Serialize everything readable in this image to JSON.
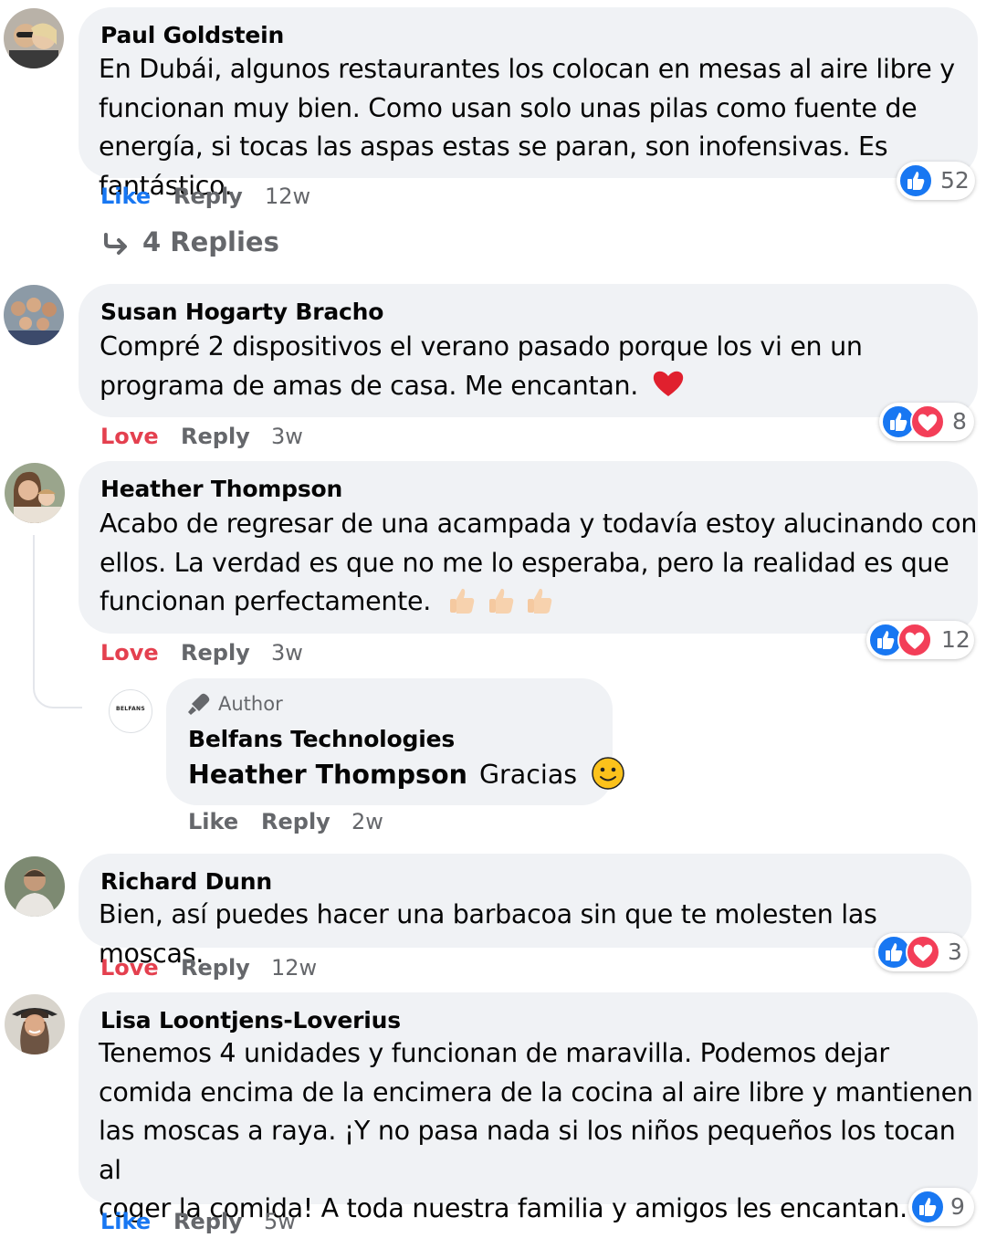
{
  "comments": [
    {
      "author": "Paul Goldstein",
      "lines": [
        "En Dubái, algunos restaurantes los colocan en mesas al aire libre y",
        "funcionan muy bien. Como usan solo unas pilas como fuente de",
        "energía, si tocas las aspas estas se paran, son inofensivas. Es fantástico."
      ],
      "action": "Like",
      "reply": "Reply",
      "time": "12w",
      "reaction_count": "52",
      "replies_label": "4 Replies"
    },
    {
      "author": "Susan Hogarty Bracho",
      "lines": [
        "Compré 2 dispositivos el verano pasado porque los vi en un",
        "programa de amas de casa. Me encantan."
      ],
      "emoji": "heart",
      "action": "Love",
      "reply": "Reply",
      "time": "3w",
      "reaction_count": "8"
    },
    {
      "author": "Heather Thompson",
      "lines": [
        "Acabo de regresar de una acampada y todavía estoy alucinando con",
        "ellos. La verdad es que no me lo esperaba, pero la realidad es que",
        "funcionan perfectamente."
      ],
      "emoji": "thumbs-up x3",
      "action": "Love",
      "reply": "Reply",
      "time": "3w",
      "reaction_count": "12"
    },
    {
      "author": "Richard Dunn",
      "lines": [
        "Bien, así puedes hacer una barbacoa sin que te molesten las moscas."
      ],
      "action": "Love",
      "reply": "Reply",
      "time": "12w",
      "reaction_count": "3"
    },
    {
      "author": "Lisa Loontjens-Loverius",
      "lines": [
        "Tenemos 4 unidades y funcionan de maravilla. Podemos dejar",
        "comida encima de la encimera de la cocina al aire libre y mantienen",
        "las moscas a raya. ¡Y no pasa nada si los niños pequeños los tocan al",
        "coger la comida! A toda nuestra familia y amigos les encantan."
      ],
      "action": "Like",
      "reply": "Reply",
      "time": "5w",
      "reaction_count": "9"
    }
  ],
  "author_reply": {
    "badge": "Author",
    "author": "Belfans Technologies",
    "avatar_text": "BELFANS",
    "mention": "Heather Thompson",
    "text": "Gracias",
    "action": "Like",
    "reply": "Reply",
    "time": "2w"
  },
  "colors": {
    "bubble": "#f0f2f5",
    "like_blue": "#1877f2",
    "love_red": "#e4404f",
    "secondary_text": "#65676b"
  }
}
